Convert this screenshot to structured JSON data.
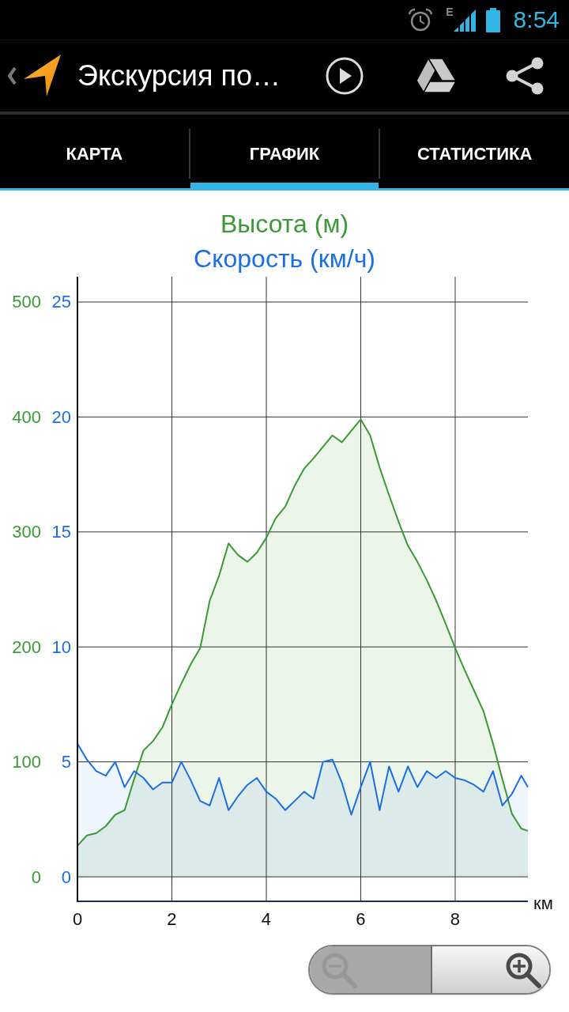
{
  "status_bar": {
    "network_type": "E",
    "time": "8:54"
  },
  "action_bar": {
    "title": "Экскурсия по…"
  },
  "tabs": [
    {
      "label": "КАРТА",
      "selected": false
    },
    {
      "label": "ГРАФИК",
      "selected": true
    },
    {
      "label": "СТАТИСТИКА",
      "selected": false
    }
  ],
  "graph": {
    "chart_data": {
      "type": "area",
      "xlabel": "км",
      "x": [
        0,
        0.2,
        0.4,
        0.6,
        0.8,
        1,
        1.2,
        1.4,
        1.6,
        1.8,
        2,
        2.2,
        2.4,
        2.6,
        2.8,
        3,
        3.2,
        3.4,
        3.6,
        3.8,
        4,
        4.2,
        4.4,
        4.6,
        4.8,
        5,
        5.2,
        5.4,
        5.6,
        5.8,
        6,
        6.2,
        6.4,
        6.6,
        6.8,
        7,
        7.2,
        7.4,
        7.6,
        7.8,
        8,
        8.2,
        8.4,
        8.6,
        8.8,
        9,
        9.2,
        9.4,
        9.54
      ],
      "series": [
        {
          "name": "Высота (м)",
          "color": "#3a9a35",
          "axis": "y",
          "values": [
            27,
            36,
            38,
            44,
            54,
            58,
            85,
            110,
            118,
            130,
            150,
            168,
            185,
            199,
            240,
            262,
            290,
            280,
            274,
            282,
            295,
            312,
            322,
            340,
            355,
            364,
            374,
            384,
            378,
            388,
            398,
            384,
            356,
            332,
            309,
            288,
            274,
            258,
            240,
            220,
            199,
            180,
            162,
            144,
            116,
            85,
            55,
            42,
            40
          ]
        },
        {
          "name": "Скорость (км/ч)",
          "color": "#1a6ee8",
          "axis": "y2",
          "values": [
            5.8,
            5.1,
            4.6,
            4.4,
            5.0,
            3.9,
            4.6,
            4.3,
            3.8,
            4.1,
            4.1,
            5.0,
            4.2,
            3.3,
            3.1,
            4.3,
            2.9,
            3.5,
            4.0,
            4.3,
            3.7,
            3.4,
            2.9,
            3.3,
            3.7,
            3.4,
            5.0,
            5.1,
            4.1,
            2.7,
            3.9,
            5.0,
            2.9,
            4.8,
            3.7,
            4.8,
            3.9,
            4.6,
            4.3,
            4.6,
            4.3,
            4.2,
            4.0,
            3.7,
            4.6,
            3.1,
            3.6,
            4.4,
            3.9
          ]
        }
      ],
      "xlim": [
        0,
        9.54
      ],
      "xticks": [
        0,
        2,
        4,
        6,
        8
      ],
      "ylim": [
        -21.3,
        522
      ],
      "yticks": [
        0,
        100,
        200,
        300,
        400,
        500
      ],
      "y2lim": [
        -1.065,
        26.1
      ],
      "y2ticks": [
        0,
        5,
        10,
        15,
        20,
        25
      ],
      "grid": true
    }
  },
  "zoom_controls": {
    "zoom_out": {
      "disabled": true
    },
    "zoom_in": {
      "disabled": false
    }
  }
}
